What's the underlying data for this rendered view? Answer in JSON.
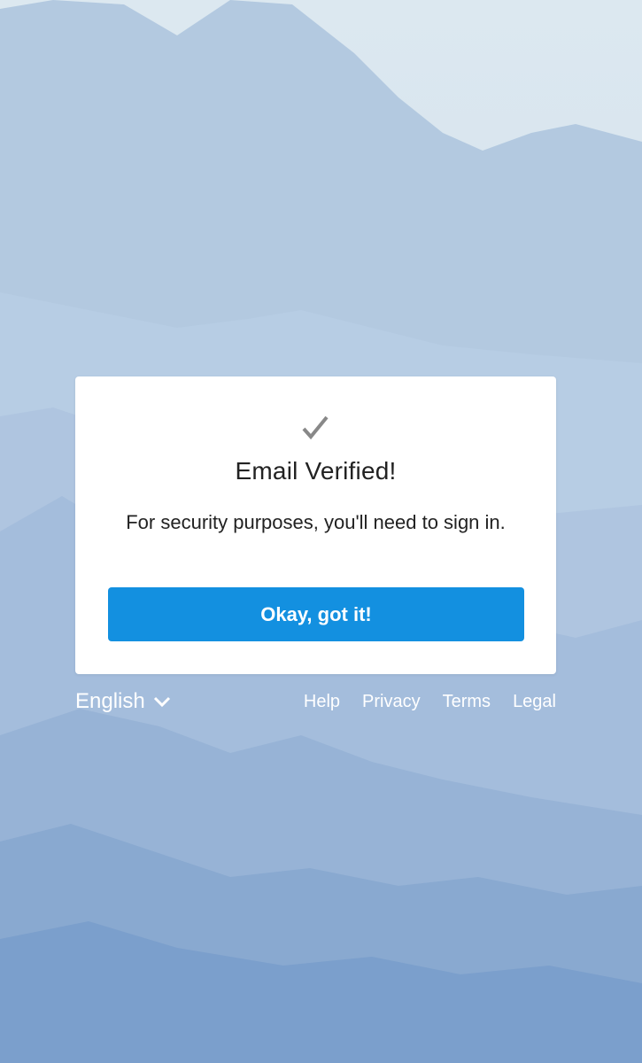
{
  "dialog": {
    "icon": "checkmark-icon",
    "title": "Email Verified!",
    "message": "For security purposes, you'll need to sign in.",
    "button_label": "Okay, got it!"
  },
  "footer": {
    "language": "English",
    "language_icon": "chevron-down-icon",
    "links": [
      "Help",
      "Privacy",
      "Terms",
      "Legal"
    ]
  },
  "colors": {
    "primary_button": "#1390e0",
    "card_background": "#ffffff",
    "text": "#222222",
    "checkmark": "#888888"
  }
}
